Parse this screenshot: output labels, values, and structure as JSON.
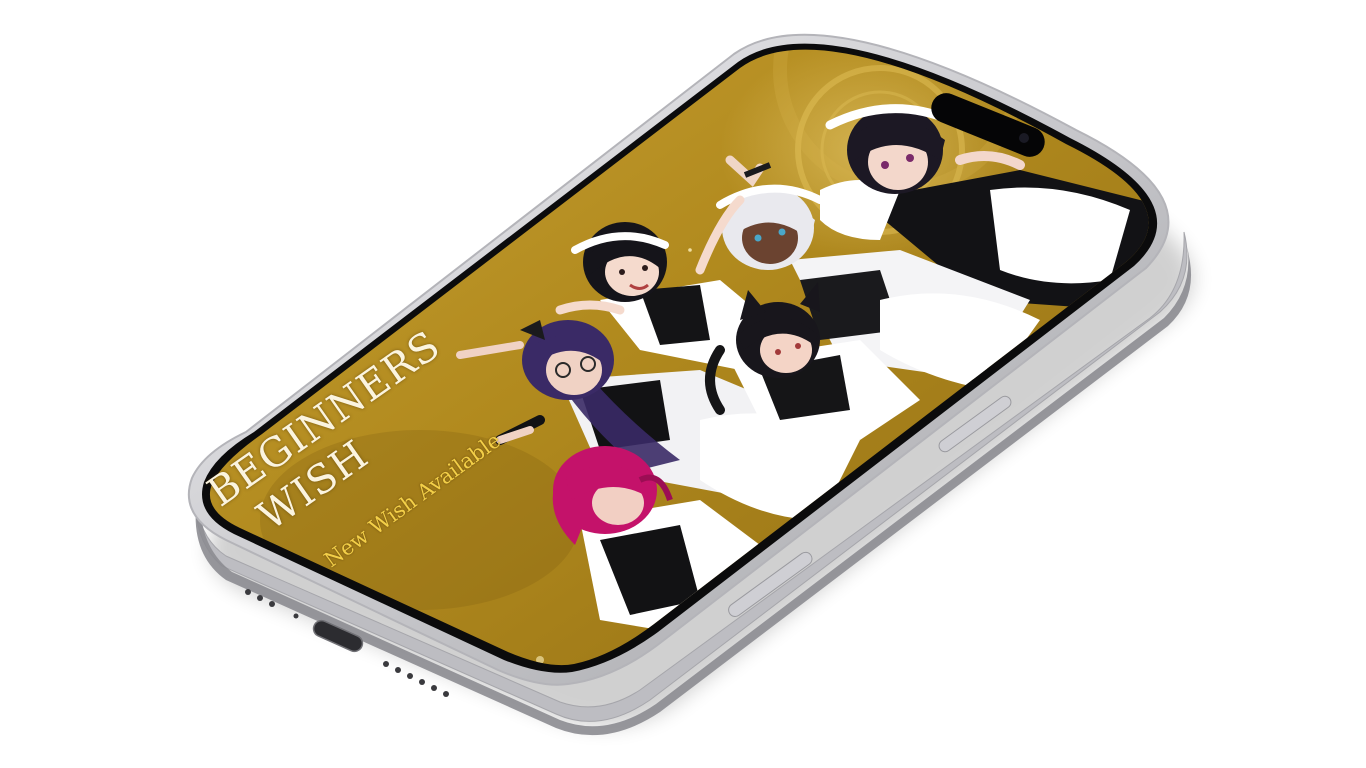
{
  "banner": {
    "title_line1": "BEGINNERS",
    "title_line2": "WISH",
    "subtitle": "New Wish Available"
  },
  "characters": [
    {
      "name": "maid-black-hair-top",
      "hair": "#1c1824",
      "skin": "#f3d7cb"
    },
    {
      "name": "maid-white-hair",
      "hair": "#e9e9ee",
      "skin": "#6b4330"
    },
    {
      "name": "maid-short-black-hair",
      "hair": "#15141a",
      "skin": "#f5dacd"
    },
    {
      "name": "maid-purple-hair",
      "hair": "#3a2a66",
      "skin": "#f0d2c4"
    },
    {
      "name": "maid-cat-ears",
      "hair": "#18161c",
      "skin": "#f4d4c6"
    },
    {
      "name": "maid-pink-hair",
      "hair": "#c4126a",
      "skin": "#f2cfc3"
    }
  ],
  "colors": {
    "background_gold": "#b18a1e",
    "gold_dark": "#7a5a10",
    "gold_light": "#d9b446",
    "frame_silver": "#d8d8dc",
    "bezel": "#0b0b0c",
    "title": "#fbf4df",
    "subtitle": "#f3cf48"
  }
}
